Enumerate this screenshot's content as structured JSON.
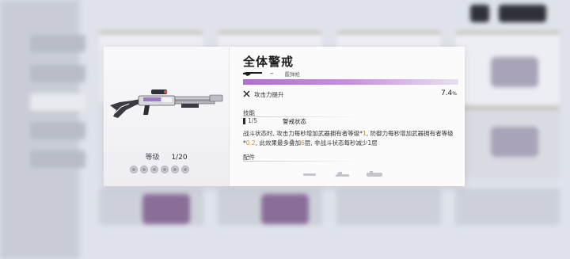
{
  "weapon": {
    "name": "全体警戒",
    "type_dash": "–",
    "type_label": "霰弹枪",
    "level_label": "等级",
    "level_value": "1/20",
    "rarity_color": "#b06fd1"
  },
  "stat": {
    "name": "攻击力提升",
    "value": "7.4",
    "unit": "%"
  },
  "skill": {
    "section_label": "技能",
    "level": "1/5",
    "name": "警戒状态",
    "desc_parts": [
      {
        "t": "战斗状态时, 攻击力每秒增加武器拥有者等级*",
        "hl": false
      },
      {
        "t": "1",
        "hl": true
      },
      {
        "t": ", 防御力每秒增加武器拥有者等级*",
        "hl": false
      },
      {
        "t": "0.2",
        "hl": true
      },
      {
        "t": ", 此效果最多叠加",
        "hl": false
      },
      {
        "t": "6",
        "hl": true
      },
      {
        "t": "层, 非战斗状态每秒减少1层",
        "hl": false
      }
    ]
  },
  "attachments": {
    "section_label": "配件",
    "icons": [
      "muzzle-icon",
      "stock-icon",
      "scope-icon"
    ]
  },
  "highlight_color": "#d6882f",
  "enhance_slots": 6
}
